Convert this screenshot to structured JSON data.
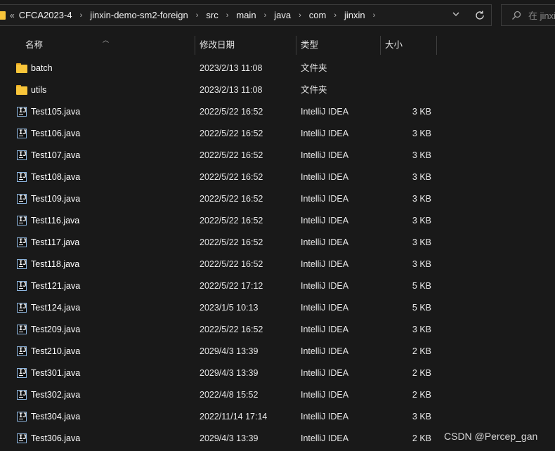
{
  "address_bar": {
    "overflow_glyph": "«",
    "breadcrumbs": [
      "CFCA2023-4",
      "jinxin-demo-sm2-foreign",
      "src",
      "main",
      "java",
      "com",
      "jinxin"
    ],
    "search_placeholder": "在 jinxi"
  },
  "columns": {
    "name": "名称",
    "date": "修改日期",
    "type": "类型",
    "size": "大小"
  },
  "files": [
    {
      "icon": "folder-icon",
      "name": "batch",
      "date": "2023/2/13 11:08",
      "type": "文件夹",
      "size": ""
    },
    {
      "icon": "folder-icon",
      "name": "utils",
      "date": "2023/2/13 11:08",
      "type": "文件夹",
      "size": ""
    },
    {
      "icon": "intellij-icon",
      "name": "Test105.java",
      "date": "2022/5/22 16:52",
      "type": "IntelliJ IDEA",
      "size": "3 KB"
    },
    {
      "icon": "intellij-icon",
      "name": "Test106.java",
      "date": "2022/5/22 16:52",
      "type": "IntelliJ IDEA",
      "size": "3 KB"
    },
    {
      "icon": "intellij-icon",
      "name": "Test107.java",
      "date": "2022/5/22 16:52",
      "type": "IntelliJ IDEA",
      "size": "3 KB"
    },
    {
      "icon": "intellij-icon",
      "name": "Test108.java",
      "date": "2022/5/22 16:52",
      "type": "IntelliJ IDEA",
      "size": "3 KB"
    },
    {
      "icon": "intellij-icon",
      "name": "Test109.java",
      "date": "2022/5/22 16:52",
      "type": "IntelliJ IDEA",
      "size": "3 KB"
    },
    {
      "icon": "intellij-icon",
      "name": "Test116.java",
      "date": "2022/5/22 16:52",
      "type": "IntelliJ IDEA",
      "size": "3 KB"
    },
    {
      "icon": "intellij-icon",
      "name": "Test117.java",
      "date": "2022/5/22 16:52",
      "type": "IntelliJ IDEA",
      "size": "3 KB"
    },
    {
      "icon": "intellij-icon",
      "name": "Test118.java",
      "date": "2022/5/22 16:52",
      "type": "IntelliJ IDEA",
      "size": "3 KB"
    },
    {
      "icon": "intellij-icon",
      "name": "Test121.java",
      "date": "2022/5/22 17:12",
      "type": "IntelliJ IDEA",
      "size": "5 KB"
    },
    {
      "icon": "intellij-icon",
      "name": "Test124.java",
      "date": "2023/1/5 10:13",
      "type": "IntelliJ IDEA",
      "size": "5 KB"
    },
    {
      "icon": "intellij-icon",
      "name": "Test209.java",
      "date": "2022/5/22 16:52",
      "type": "IntelliJ IDEA",
      "size": "3 KB"
    },
    {
      "icon": "intellij-icon",
      "name": "Test210.java",
      "date": "2029/4/3 13:39",
      "type": "IntelliJ IDEA",
      "size": "2 KB"
    },
    {
      "icon": "intellij-icon",
      "name": "Test301.java",
      "date": "2029/4/3 13:39",
      "type": "IntelliJ IDEA",
      "size": "2 KB"
    },
    {
      "icon": "intellij-icon",
      "name": "Test302.java",
      "date": "2022/4/8 15:52",
      "type": "IntelliJ IDEA",
      "size": "2 KB"
    },
    {
      "icon": "intellij-icon",
      "name": "Test304.java",
      "date": "2022/11/14 17:14",
      "type": "IntelliJ IDEA",
      "size": "3 KB"
    },
    {
      "icon": "intellij-icon",
      "name": "Test306.java",
      "date": "2029/4/3 13:39",
      "type": "IntelliJ IDEA",
      "size": "2 KB"
    }
  ],
  "watermark": "CSDN @Percep_gan",
  "colors": {
    "background": "#191919",
    "folder": "#f8c53a",
    "text": "#ffffff"
  }
}
